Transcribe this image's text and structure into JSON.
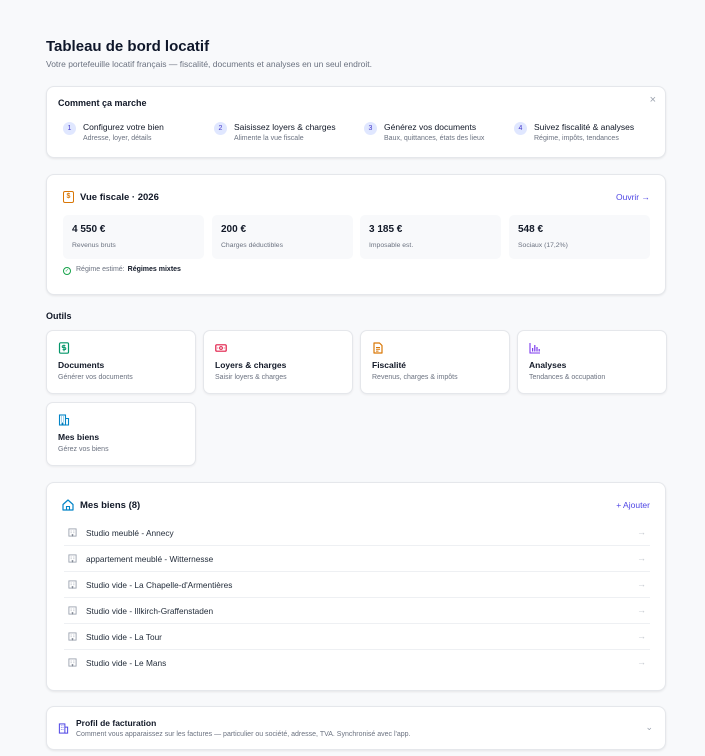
{
  "header": {
    "title": "Tableau de bord locatif",
    "subtitle": "Votre portefeuille locatif français — fiscalité, documents et analyses en un seul endroit."
  },
  "how": {
    "title": "Comment ça marche",
    "close": "×",
    "steps": [
      {
        "num": "1",
        "title": "Configurez votre bien",
        "desc": "Adresse, loyer, détails"
      },
      {
        "num": "2",
        "title": "Saisissez loyers & charges",
        "desc": "Alimente la vue fiscale"
      },
      {
        "num": "3",
        "title": "Générez vos documents",
        "desc": "Baux, quittances, états des lieux"
      },
      {
        "num": "4",
        "title": "Suivez fiscalité & analyses",
        "desc": "Régime, impôts, tendances"
      }
    ]
  },
  "fiscal": {
    "title": "Vue fiscale · 2026",
    "icon_glyph": "$",
    "open": "Ouvrir →",
    "metrics": [
      {
        "value": "4 550 €",
        "label": "Revenus bruts"
      },
      {
        "value": "200 €",
        "label": "Charges déductibles"
      },
      {
        "value": "3 185 €",
        "label": "Imposable est."
      },
      {
        "value": "548 €",
        "label": "Sociaux (17,2%)"
      }
    ],
    "regime_label": "Régime estimé:",
    "regime_value": "Régimes mixtes"
  },
  "tools": {
    "label": "Outils",
    "items": [
      {
        "title": "Documents",
        "desc": "Générer vos documents",
        "icon": "dollar-doc-icon",
        "color": "#059669"
      },
      {
        "title": "Loyers & charges",
        "desc": "Saisir loyers & charges",
        "icon": "banknote-icon",
        "color": "#e11d48"
      },
      {
        "title": "Fiscalité",
        "desc": "Revenus, charges & impôts",
        "icon": "file-text-icon",
        "color": "#d97706"
      },
      {
        "title": "Analyses",
        "desc": "Tendances & occupation",
        "icon": "bar-chart-icon",
        "color": "#7c3aed"
      },
      {
        "title": "Mes biens",
        "desc": "Gérez vos biens",
        "icon": "building-icon",
        "color": "#0284c7"
      }
    ]
  },
  "properties": {
    "title": "Mes biens (8)",
    "add": "+ Ajouter",
    "arrow": "→",
    "items": [
      {
        "name": "Studio meublé - Annecy"
      },
      {
        "name": "appartement meublé - Witternesse"
      },
      {
        "name": "Studio vide - La Chapelle-d'Armentières"
      },
      {
        "name": "Studio vide - Illkirch-Graffenstaden"
      },
      {
        "name": "Studio vide - La Tour"
      },
      {
        "name": "Studio vide - Le Mans"
      }
    ]
  },
  "billing": {
    "title": "Profil de facturation",
    "desc": "Comment vous apparaissez sur les factures — particulier ou société, adresse, TVA. Synchronisé avec l'app.",
    "chevron": "⌄"
  }
}
